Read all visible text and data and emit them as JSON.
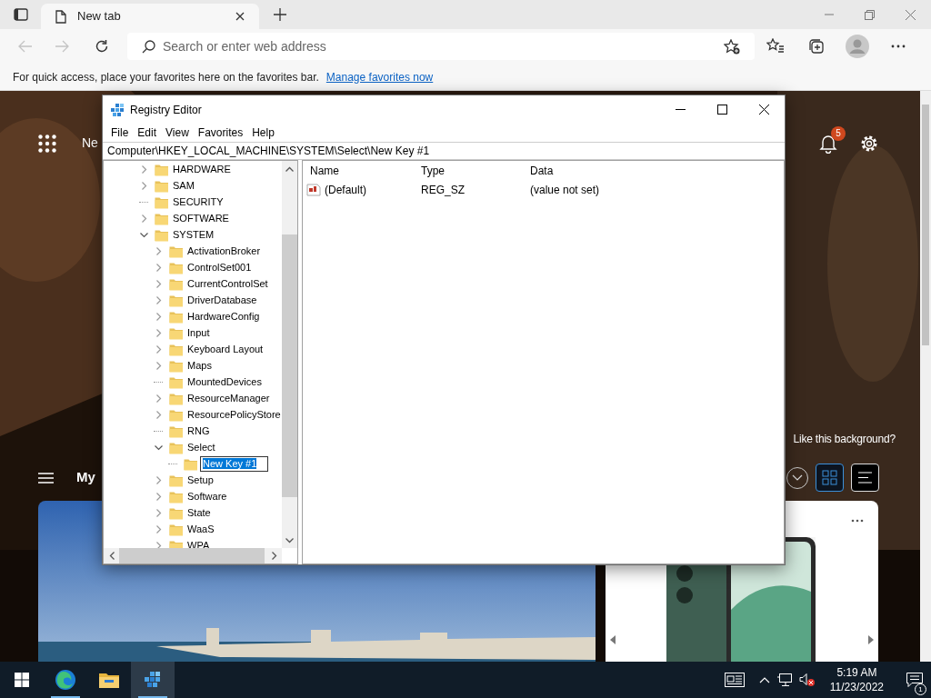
{
  "browser": {
    "tab": {
      "title": "New tab"
    },
    "address_bar": {
      "placeholder": "Search or enter web address"
    },
    "favorites_bar": {
      "text": "For quick access, place your favorites here on the favorites bar.",
      "link": "Manage favorites now"
    }
  },
  "new_tab_page": {
    "top_link": "Ne",
    "notifications_badge": "5",
    "background_prompt": "Like this background?",
    "feed_title": "My",
    "layout_buttons": [
      {
        "kind": "grid",
        "selected": true
      },
      {
        "kind": "list",
        "selected": false
      }
    ]
  },
  "registry_editor": {
    "title": "Registry Editor",
    "menu": [
      "File",
      "Edit",
      "View",
      "Favorites",
      "Help"
    ],
    "address": "Computer\\HKEY_LOCAL_MACHINE\\SYSTEM\\Select\\New Key #1",
    "tree": [
      {
        "name": "HARDWARE",
        "expandable": true,
        "expanded": false,
        "editing": false
      },
      {
        "name": "SAM",
        "expandable": true,
        "expanded": false,
        "editing": false
      },
      {
        "name": "SECURITY",
        "expandable": false,
        "expanded": false,
        "editing": false
      },
      {
        "name": "SOFTWARE",
        "expandable": true,
        "expanded": false,
        "editing": false
      },
      {
        "name": "SYSTEM",
        "expandable": true,
        "expanded": true,
        "editing": false,
        "children": [
          {
            "name": "ActivationBroker",
            "expandable": true,
            "expanded": false,
            "editing": false
          },
          {
            "name": "ControlSet001",
            "expandable": true,
            "expanded": false,
            "editing": false
          },
          {
            "name": "CurrentControlSet",
            "expandable": true,
            "expanded": false,
            "editing": false
          },
          {
            "name": "DriverDatabase",
            "expandable": true,
            "expanded": false,
            "editing": false
          },
          {
            "name": "HardwareConfig",
            "expandable": true,
            "expanded": false,
            "editing": false
          },
          {
            "name": "Input",
            "expandable": true,
            "expanded": false,
            "editing": false
          },
          {
            "name": "Keyboard Layout",
            "expandable": true,
            "expanded": false,
            "editing": false
          },
          {
            "name": "Maps",
            "expandable": true,
            "expanded": false,
            "editing": false
          },
          {
            "name": "MountedDevices",
            "expandable": false,
            "expanded": false,
            "editing": false
          },
          {
            "name": "ResourceManager",
            "expandable": true,
            "expanded": false,
            "editing": false
          },
          {
            "name": "ResourcePolicyStore",
            "expandable": true,
            "expanded": false,
            "editing": false
          },
          {
            "name": "RNG",
            "expandable": false,
            "expanded": false,
            "editing": false
          },
          {
            "name": "Select",
            "expandable": true,
            "expanded": true,
            "editing": false,
            "children": [
              {
                "name": "New Key #1",
                "expandable": false,
                "expanded": false,
                "editing": true
              }
            ]
          },
          {
            "name": "Setup",
            "expandable": true,
            "expanded": false,
            "editing": false
          },
          {
            "name": "Software",
            "expandable": true,
            "expanded": false,
            "editing": false
          },
          {
            "name": "State",
            "expandable": true,
            "expanded": false,
            "editing": false
          },
          {
            "name": "WaaS",
            "expandable": true,
            "expanded": false,
            "editing": false
          },
          {
            "name": "WPA",
            "expandable": true,
            "expanded": false,
            "editing": false
          }
        ]
      }
    ],
    "columns": [
      "Name",
      "Type",
      "Data"
    ],
    "values": [
      {
        "name": "(Default)",
        "type": "REG_SZ",
        "data": "(value not set)"
      }
    ]
  },
  "taskbar": {
    "apps": [
      {
        "kind": "browser",
        "running": true,
        "active": false
      },
      {
        "kind": "folder",
        "running": false,
        "active": false
      },
      {
        "kind": "registry",
        "running": true,
        "active": true
      }
    ],
    "time": "5:19 AM",
    "date": "11/23/2022",
    "notification_count": "1"
  }
}
